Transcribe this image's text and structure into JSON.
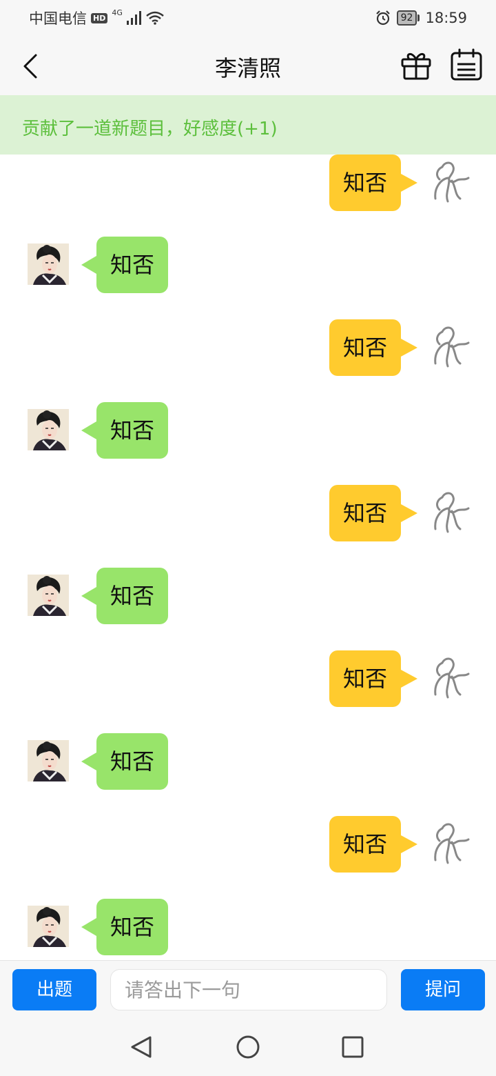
{
  "status": {
    "carrier": "中国电信",
    "hd": "HD",
    "network": "4G",
    "battery": "92",
    "time": "18:59"
  },
  "header": {
    "title": "李清照"
  },
  "banner": {
    "text": "贡献了一道新题目，好感度(+1)"
  },
  "messages": [
    {
      "side": "out",
      "text": "知否"
    },
    {
      "side": "in",
      "text": "知否"
    },
    {
      "side": "out",
      "text": "知否"
    },
    {
      "side": "in",
      "text": "知否"
    },
    {
      "side": "out",
      "text": "知否"
    },
    {
      "side": "in",
      "text": "知否"
    },
    {
      "side": "out",
      "text": "知否"
    },
    {
      "side": "in",
      "text": "知否"
    },
    {
      "side": "out",
      "text": "知否"
    },
    {
      "side": "in",
      "text": "知否"
    }
  ],
  "input_bar": {
    "question_label": "出题",
    "placeholder": "请答出下一句",
    "ask_label": "提问"
  },
  "colors": {
    "accent": "#0a7cf5",
    "banner_bg": "#dcf2d4",
    "banner_text": "#5cbf3c",
    "bubble_out": "#ffcb2e",
    "bubble_in": "#98e46a"
  },
  "icons": [
    "back-arrow-icon",
    "gift-icon",
    "calendar-icon",
    "user-sketch-icon",
    "avatar-portrait",
    "nav-back-icon",
    "nav-home-icon",
    "nav-recent-icon"
  ]
}
